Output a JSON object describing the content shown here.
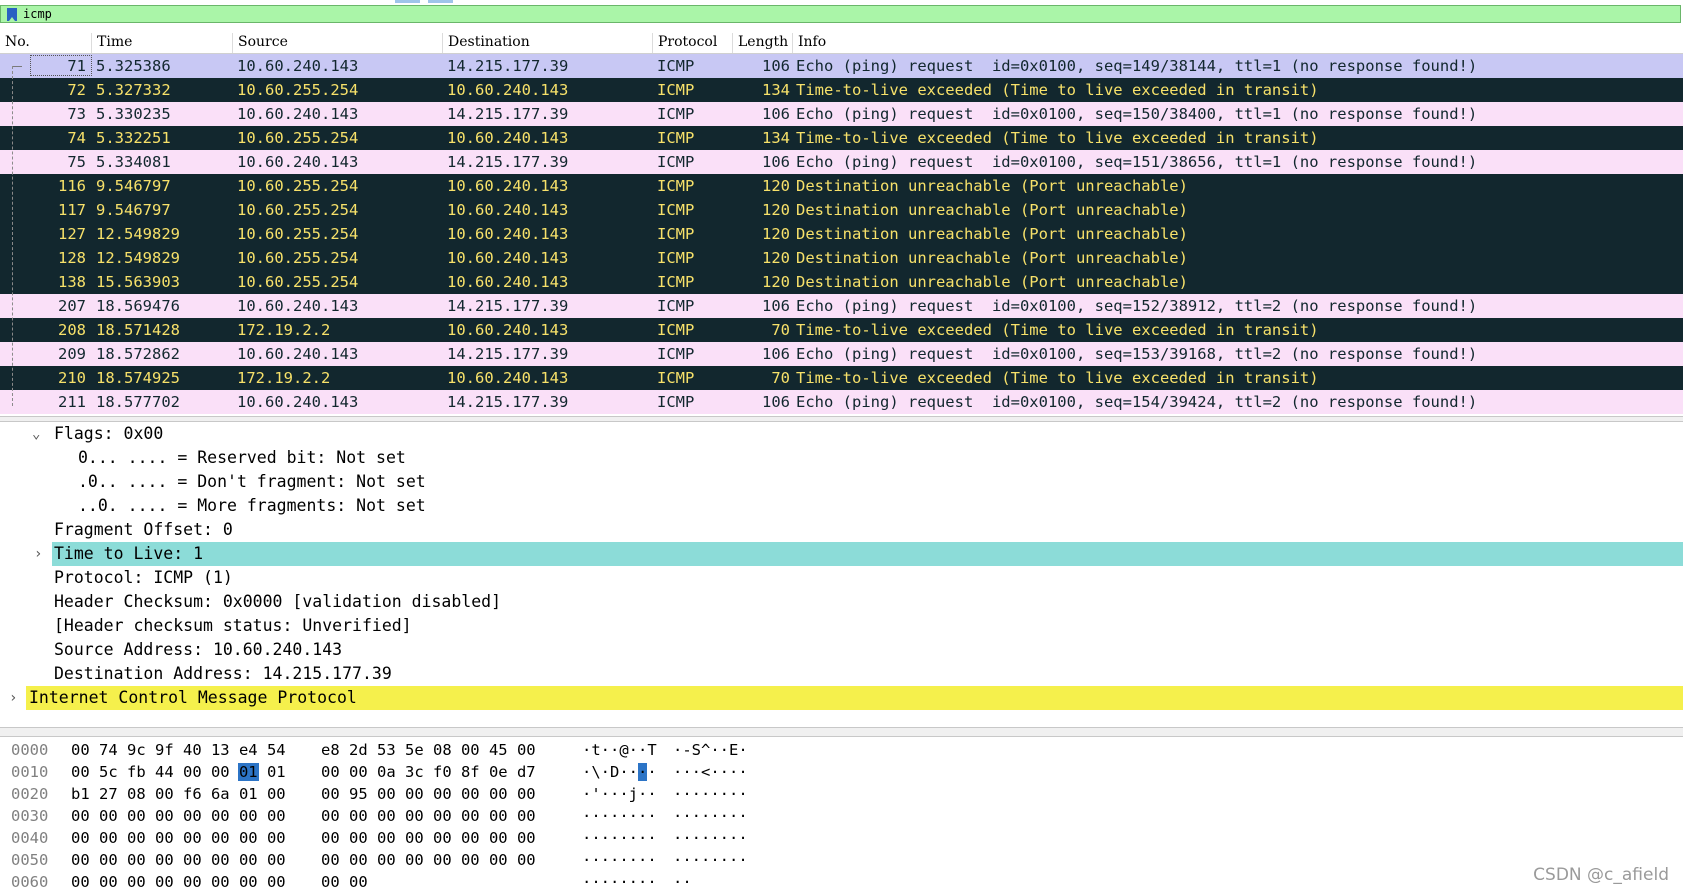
{
  "filter": {
    "value": "icmp"
  },
  "columns": [
    "No.",
    "Time",
    "Source",
    "Destination",
    "Protocol",
    "Length",
    "Info"
  ],
  "colors": {
    "request_bg": "#fae0f8",
    "request_fg": "#12272e",
    "dark_bg": "#12272e",
    "dark_fg": "#f7e16a",
    "selected_bg": "#c8c8f4",
    "selected_fg": "#12272e",
    "ttl_highlight": "#8cdcd8",
    "icmp_highlight": "#f5f04c"
  },
  "packets": [
    {
      "no": "71",
      "time": "5.325386",
      "src": "10.60.240.143",
      "dst": "14.215.177.39",
      "proto": "ICMP",
      "len": "106",
      "info": "Echo (ping) request  id=0x0100, seq=149/38144, ttl=1 (no response found!)",
      "style": "selected"
    },
    {
      "no": "72",
      "time": "5.327332",
      "src": "10.60.255.254",
      "dst": "10.60.240.143",
      "proto": "ICMP",
      "len": "134",
      "info": "Time-to-live exceeded (Time to live exceeded in transit)",
      "style": "dark"
    },
    {
      "no": "73",
      "time": "5.330235",
      "src": "10.60.240.143",
      "dst": "14.215.177.39",
      "proto": "ICMP",
      "len": "106",
      "info": "Echo (ping) request  id=0x0100, seq=150/38400, ttl=1 (no response found!)",
      "style": "request"
    },
    {
      "no": "74",
      "time": "5.332251",
      "src": "10.60.255.254",
      "dst": "10.60.240.143",
      "proto": "ICMP",
      "len": "134",
      "info": "Time-to-live exceeded (Time to live exceeded in transit)",
      "style": "dark"
    },
    {
      "no": "75",
      "time": "5.334081",
      "src": "10.60.240.143",
      "dst": "14.215.177.39",
      "proto": "ICMP",
      "len": "106",
      "info": "Echo (ping) request  id=0x0100, seq=151/38656, ttl=1 (no response found!)",
      "style": "request"
    },
    {
      "no": "116",
      "time": "9.546797",
      "src": "10.60.255.254",
      "dst": "10.60.240.143",
      "proto": "ICMP",
      "len": "120",
      "info": "Destination unreachable (Port unreachable)",
      "style": "dark"
    },
    {
      "no": "117",
      "time": "9.546797",
      "src": "10.60.255.254",
      "dst": "10.60.240.143",
      "proto": "ICMP",
      "len": "120",
      "info": "Destination unreachable (Port unreachable)",
      "style": "dark"
    },
    {
      "no": "127",
      "time": "12.549829",
      "src": "10.60.255.254",
      "dst": "10.60.240.143",
      "proto": "ICMP",
      "len": "120",
      "info": "Destination unreachable (Port unreachable)",
      "style": "dark"
    },
    {
      "no": "128",
      "time": "12.549829",
      "src": "10.60.255.254",
      "dst": "10.60.240.143",
      "proto": "ICMP",
      "len": "120",
      "info": "Destination unreachable (Port unreachable)",
      "style": "dark"
    },
    {
      "no": "138",
      "time": "15.563903",
      "src": "10.60.255.254",
      "dst": "10.60.240.143",
      "proto": "ICMP",
      "len": "120",
      "info": "Destination unreachable (Port unreachable)",
      "style": "dark"
    },
    {
      "no": "207",
      "time": "18.569476",
      "src": "10.60.240.143",
      "dst": "14.215.177.39",
      "proto": "ICMP",
      "len": "106",
      "info": "Echo (ping) request  id=0x0100, seq=152/38912, ttl=2 (no response found!)",
      "style": "request"
    },
    {
      "no": "208",
      "time": "18.571428",
      "src": "172.19.2.2",
      "dst": "10.60.240.143",
      "proto": "ICMP",
      "len": "70",
      "info": "Time-to-live exceeded (Time to live exceeded in transit)",
      "style": "dark"
    },
    {
      "no": "209",
      "time": "18.572862",
      "src": "10.60.240.143",
      "dst": "14.215.177.39",
      "proto": "ICMP",
      "len": "106",
      "info": "Echo (ping) request  id=0x0100, seq=153/39168, ttl=2 (no response found!)",
      "style": "request"
    },
    {
      "no": "210",
      "time": "18.574925",
      "src": "172.19.2.2",
      "dst": "10.60.240.143",
      "proto": "ICMP",
      "len": "70",
      "info": "Time-to-live exceeded (Time to live exceeded in transit)",
      "style": "dark"
    },
    {
      "no": "211",
      "time": "18.577702",
      "src": "10.60.240.143",
      "dst": "14.215.177.39",
      "proto": "ICMP",
      "len": "106",
      "info": "Echo (ping) request  id=0x0100, seq=154/39424, ttl=2 (no response found!)",
      "style": "request"
    }
  ],
  "details": {
    "flags": "Flags: 0x00",
    "reserved": "0... .... = Reserved bit: Not set",
    "dont_fragment": ".0.. .... = Don't fragment: Not set",
    "more_fragments": "..0. .... = More fragments: Not set",
    "frag_offset": "Fragment Offset: 0",
    "ttl": "Time to Live: 1",
    "protocol": "Protocol: ICMP (1)",
    "checksum": "Header Checksum: 0x0000 [validation disabled]",
    "checksum_status": "[Header checksum status: Unverified]",
    "source": "Source Address: 10.60.240.143",
    "destination": "Destination Address: 14.215.177.39",
    "icmp": "Internet Control Message Protocol"
  },
  "hexdump": [
    {
      "offset": "0000",
      "hex_a": "00 74 9c 9f 40 13 e4 54",
      "hex_b": "e8 2d 53 5e 08 00 45 00",
      "ascii_a": "·t··@··T",
      "ascii_b": "·-S^··E·"
    },
    {
      "offset": "0010",
      "hex_a": "00 5c fb 44 00 00 01 01",
      "hex_b": "00 00 0a 3c f0 8f 0e d7",
      "ascii_a": "·\\·D····",
      "ascii_b": "···<····",
      "hl_byte": 6
    },
    {
      "offset": "0020",
      "hex_a": "b1 27 08 00 f6 6a 01 00",
      "hex_b": "00 95 00 00 00 00 00 00",
      "ascii_a": "·'···j··",
      "ascii_b": "········"
    },
    {
      "offset": "0030",
      "hex_a": "00 00 00 00 00 00 00 00",
      "hex_b": "00 00 00 00 00 00 00 00",
      "ascii_a": "········",
      "ascii_b": "········"
    },
    {
      "offset": "0040",
      "hex_a": "00 00 00 00 00 00 00 00",
      "hex_b": "00 00 00 00 00 00 00 00",
      "ascii_a": "········",
      "ascii_b": "········"
    },
    {
      "offset": "0050",
      "hex_a": "00 00 00 00 00 00 00 00",
      "hex_b": "00 00 00 00 00 00 00 00",
      "ascii_a": "········",
      "ascii_b": "········"
    },
    {
      "offset": "0060",
      "hex_a": "00 00 00 00 00 00 00 00",
      "hex_b": "00 00",
      "ascii_a": "········",
      "ascii_b": "··"
    }
  ],
  "watermark": "CSDN @c_afield"
}
